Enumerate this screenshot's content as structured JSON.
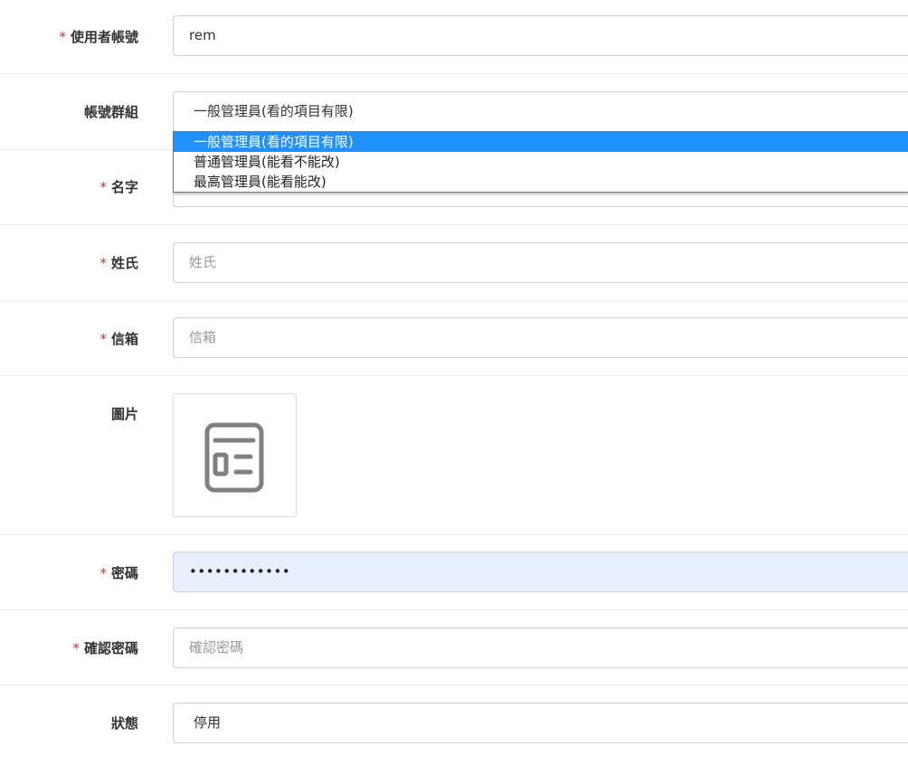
{
  "form": {
    "username": {
      "label": "使用者帳號",
      "required_mark": "*",
      "value": "rem"
    },
    "account_group": {
      "label": "帳號群組",
      "selected": "一般管理員(看的項目有限)",
      "options": [
        "一般管理員(看的項目有限)",
        "普通管理員(能看不能改)",
        "最高管理員(能看能改)"
      ]
    },
    "first_name": {
      "label": "名字",
      "required_mark": "*"
    },
    "last_name": {
      "label": "姓氏",
      "required_mark": "*",
      "placeholder": "姓氏"
    },
    "email": {
      "label": "信箱",
      "required_mark": "*",
      "placeholder": "信箱"
    },
    "image": {
      "label": "圖片",
      "icon": "image-placeholder-icon"
    },
    "password": {
      "label": "密碼",
      "required_mark": "*",
      "value": "••••••••••••"
    },
    "confirm_password": {
      "label": "確認密碼",
      "required_mark": "*",
      "placeholder": "確認密碼"
    },
    "status": {
      "label": "狀態",
      "selected": "停用"
    }
  },
  "colors": {
    "required": "#c0392b",
    "option_highlight": "#1e90ff",
    "autofill_bg": "#e8f0fe"
  }
}
